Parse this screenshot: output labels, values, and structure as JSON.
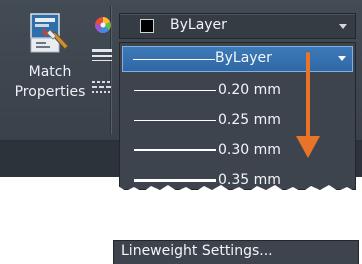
{
  "ribbon": {
    "match_label": "Match\nProperties"
  },
  "color_combo": {
    "value": "ByLayer",
    "swatch_color": "#000000"
  },
  "lineweight_dropdown": {
    "selected_label": "ByLayer",
    "items": [
      {
        "label": "0.20 mm",
        "weight": 1
      },
      {
        "label": "0.25 mm",
        "weight": 1
      },
      {
        "label": "0.30 mm",
        "weight": 2
      },
      {
        "label": "0.35 mm",
        "weight": 3
      }
    ],
    "settings_label": "Lineweight Settings..."
  },
  "colors": {
    "ribbon_bg": "#3e454e",
    "accent": "#3a72b0",
    "annotation_arrow": "#e8742a"
  }
}
